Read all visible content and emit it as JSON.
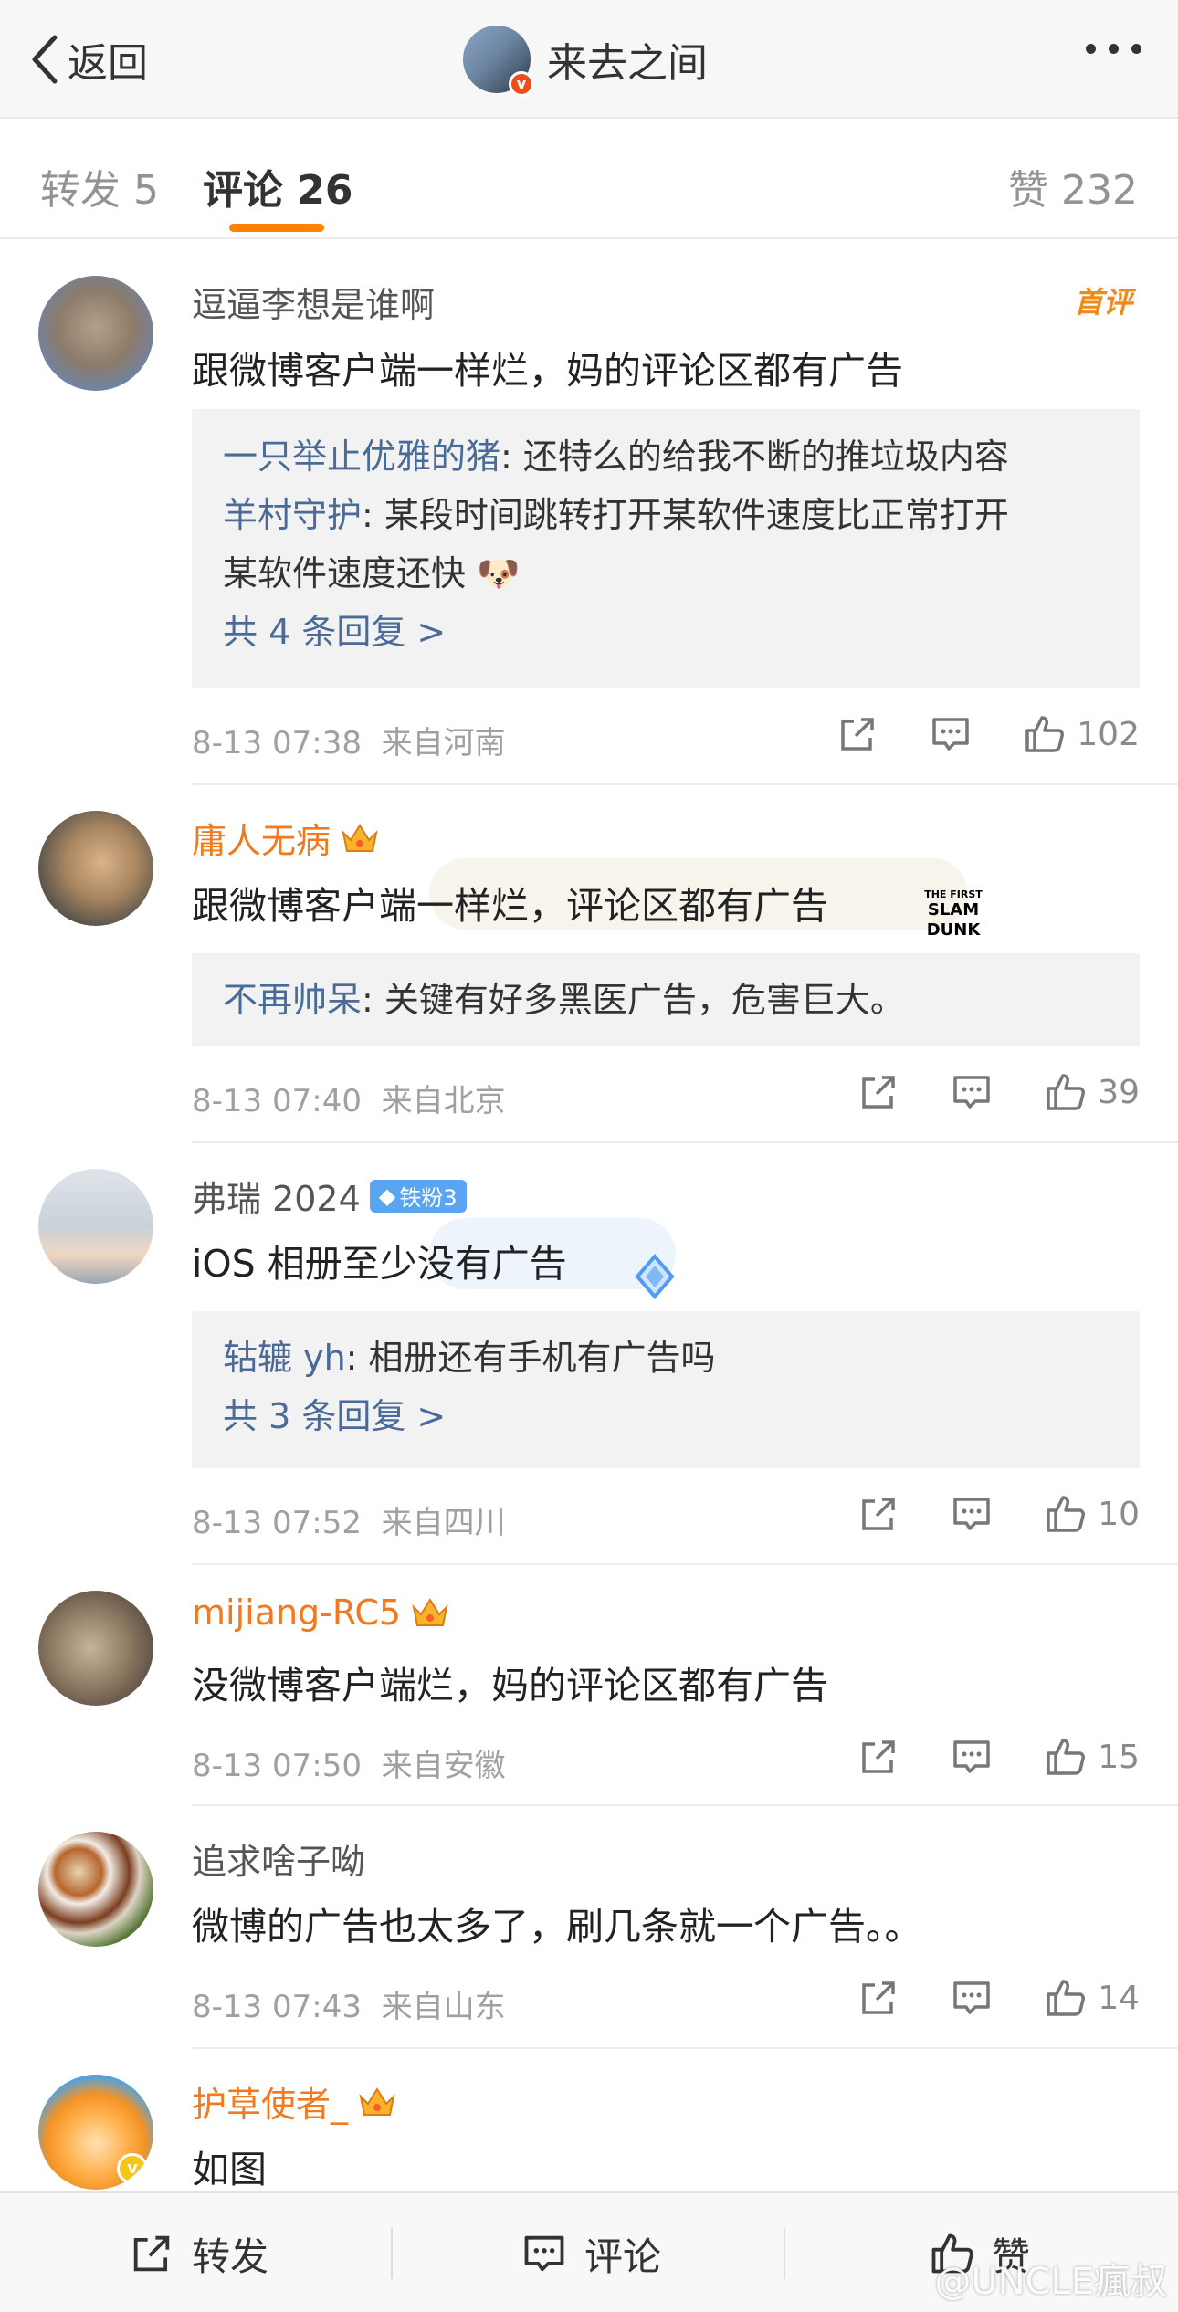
{
  "nav": {
    "back_label": "返回",
    "title": "来去之间",
    "badge": "v"
  },
  "tabs": {
    "repost": "转发 5",
    "comment": "评论 26",
    "like": "赞 232"
  },
  "comments": [
    {
      "user": "逗逼李想是谁啊",
      "tag": "首评",
      "text": "跟微博客户端一样烂，妈的评论区都有广告",
      "replies": [
        {
          "author": "一只举止优雅的猪",
          "text": ": 还特么的给我不断的推垃圾内容"
        },
        {
          "author": "羊村守护",
          "text": ": 某段时间跳转打开某软件速度比正常打开"
        },
        {
          "author": "",
          "text": "某软件速度还快"
        }
      ],
      "more": "共 4 条回复 >",
      "time": "8-13 07:38",
      "location": "来自河南",
      "likes": "102"
    },
    {
      "user": "庸人无病",
      "text": "跟微博客户端一样烂，评论区都有广告",
      "bubble": "THE FIRST SLAM DUNK",
      "replies": [
        {
          "author": "不再帅呆",
          "text": ": 关键有好多黑医广告，危害巨大。"
        }
      ],
      "time": "8-13 07:40",
      "location": "来自北京",
      "likes": "39"
    },
    {
      "user": "弗瑞 2024",
      "fan_badge": "铁粉3",
      "text": "iOS 相册至少没有广告",
      "replies": [
        {
          "author": "轱辘 yh",
          "text": ": 相册还有手机有广告吗"
        }
      ],
      "more": "共 3 条回复 >",
      "time": "8-13 07:52",
      "location": "来自四川",
      "likes": "10"
    },
    {
      "user": "mijiang-RC5",
      "text": "没微博客户端烂，妈的评论区都有广告",
      "time": "8-13 07:50",
      "location": "来自安徽",
      "likes": "15"
    },
    {
      "user": "追求啥子呦",
      "text": "微博的广告也太多了，刷几条就一个广告。。",
      "time": "8-13 07:43",
      "location": "来自山东",
      "likes": "14"
    },
    {
      "user": "护草使者_",
      "text": "如图"
    }
  ],
  "bottom": {
    "repost": "转发",
    "comment": "评论",
    "like": "赞"
  },
  "watermark": "@UNCLE瘋叔",
  "colors": {
    "accent": "#ff8200",
    "link": "#4a6a98",
    "vip_name": "#f2791d"
  }
}
